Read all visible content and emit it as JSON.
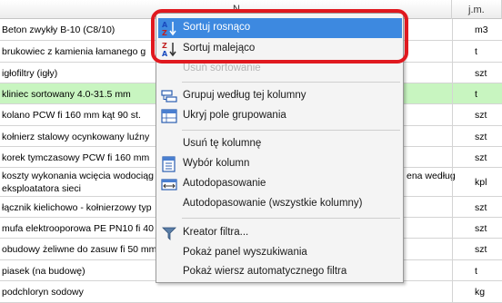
{
  "grid": {
    "header": {
      "name_col": "N",
      "unit_col": "j.m."
    },
    "rows": [
      {
        "name": "Beton zwykły B-10 (C8/10)",
        "unit": "m3"
      },
      {
        "name": "brukowiec z kamienia łamanego g",
        "unit": "t"
      },
      {
        "name": "igłofiltry (igły)",
        "unit": "szt"
      },
      {
        "name": "kliniec sortowany 4.0-31.5 mm",
        "unit": "t"
      },
      {
        "name": "kolano PCW fi 160 mm kąt 90 st.",
        "unit": "szt"
      },
      {
        "name": "kołnierz stalowy ocynkowany luźny",
        "unit": "szt"
      },
      {
        "name": "korek tymczasowy PCW fi 160 mm",
        "unit": "szt"
      },
      {
        "name": "koszty wykonania wcięcia wodociąg",
        "name_tail": "ena według",
        "name2": "eksploatatora sieci",
        "unit": "kpl"
      },
      {
        "name": "łącznik kielichowo - kołnierzowy typ",
        "unit": "szt"
      },
      {
        "name": "mufa elektrooporowa PE PN10 fi 40",
        "unit": "szt"
      },
      {
        "name": "obudowy żeliwne do zasuw fi 50 mm",
        "unit": "szt"
      },
      {
        "name": "piasek (na budowę)",
        "unit": "t"
      },
      {
        "name": "podchloryn sodowy",
        "unit": "kg"
      }
    ]
  },
  "menu": {
    "sort_asc": "Sortuj rosnąco",
    "sort_desc": "Sortuj malejąco",
    "clear_sort": "Usuń sortowanie",
    "group_by": "Grupuj według tej kolumny",
    "hide_group_panel": "Ukryj pole grupowania",
    "remove_column": "Usuń tę kolumnę",
    "choose_columns": "Wybór kolumn",
    "autofit": "Autodopasowanie",
    "autofit_all": "Autodopasowanie (wszystkie kolumny)",
    "filter_builder": "Kreator filtra...",
    "show_find_panel": "Pokaż panel wyszukiwania",
    "show_auto_filter": "Pokaż wiersz automatycznego filtra"
  },
  "colors": {
    "highlight": "#3d89e0",
    "selected_row": "#c8f5c0",
    "annotation_ring": "#e0191f"
  }
}
